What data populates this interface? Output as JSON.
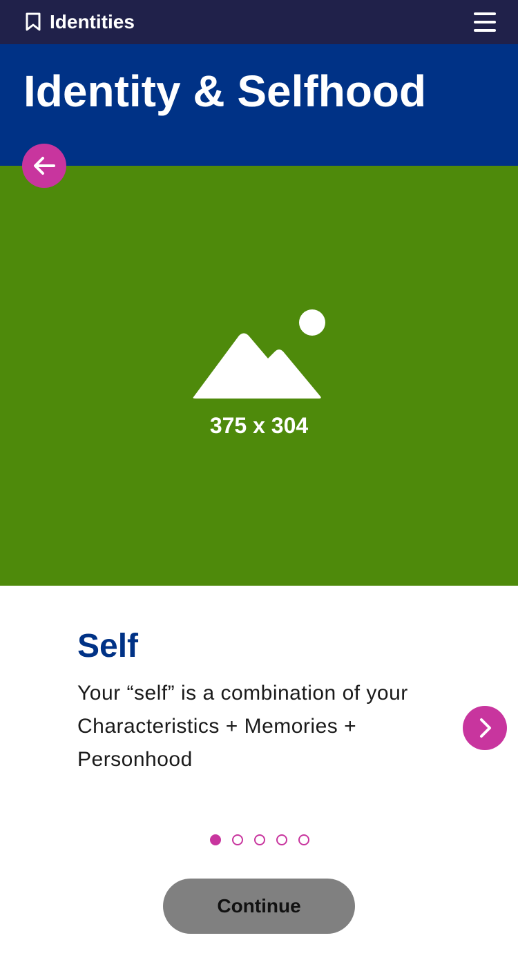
{
  "topbar": {
    "title": "Identities",
    "bookmark_icon": "bookmark-icon",
    "menu_icon": "hamburger-menu-icon"
  },
  "header": {
    "title": "Identity & Selfhood"
  },
  "hero": {
    "placeholder_label": "375 x 304",
    "placeholder_icon": "image-placeholder-icon"
  },
  "card": {
    "title": "Self",
    "body": "Your “self” is a combination of your Characteristics + Memories + Personhood"
  },
  "pager": {
    "total": 5,
    "active_index": 0
  },
  "actions": {
    "continue_label": "Continue"
  },
  "colors": {
    "topbar": "#20214a",
    "header": "#003286",
    "hero": "#4e8a0b",
    "accent": "#c8359e",
    "button": "#808080"
  }
}
